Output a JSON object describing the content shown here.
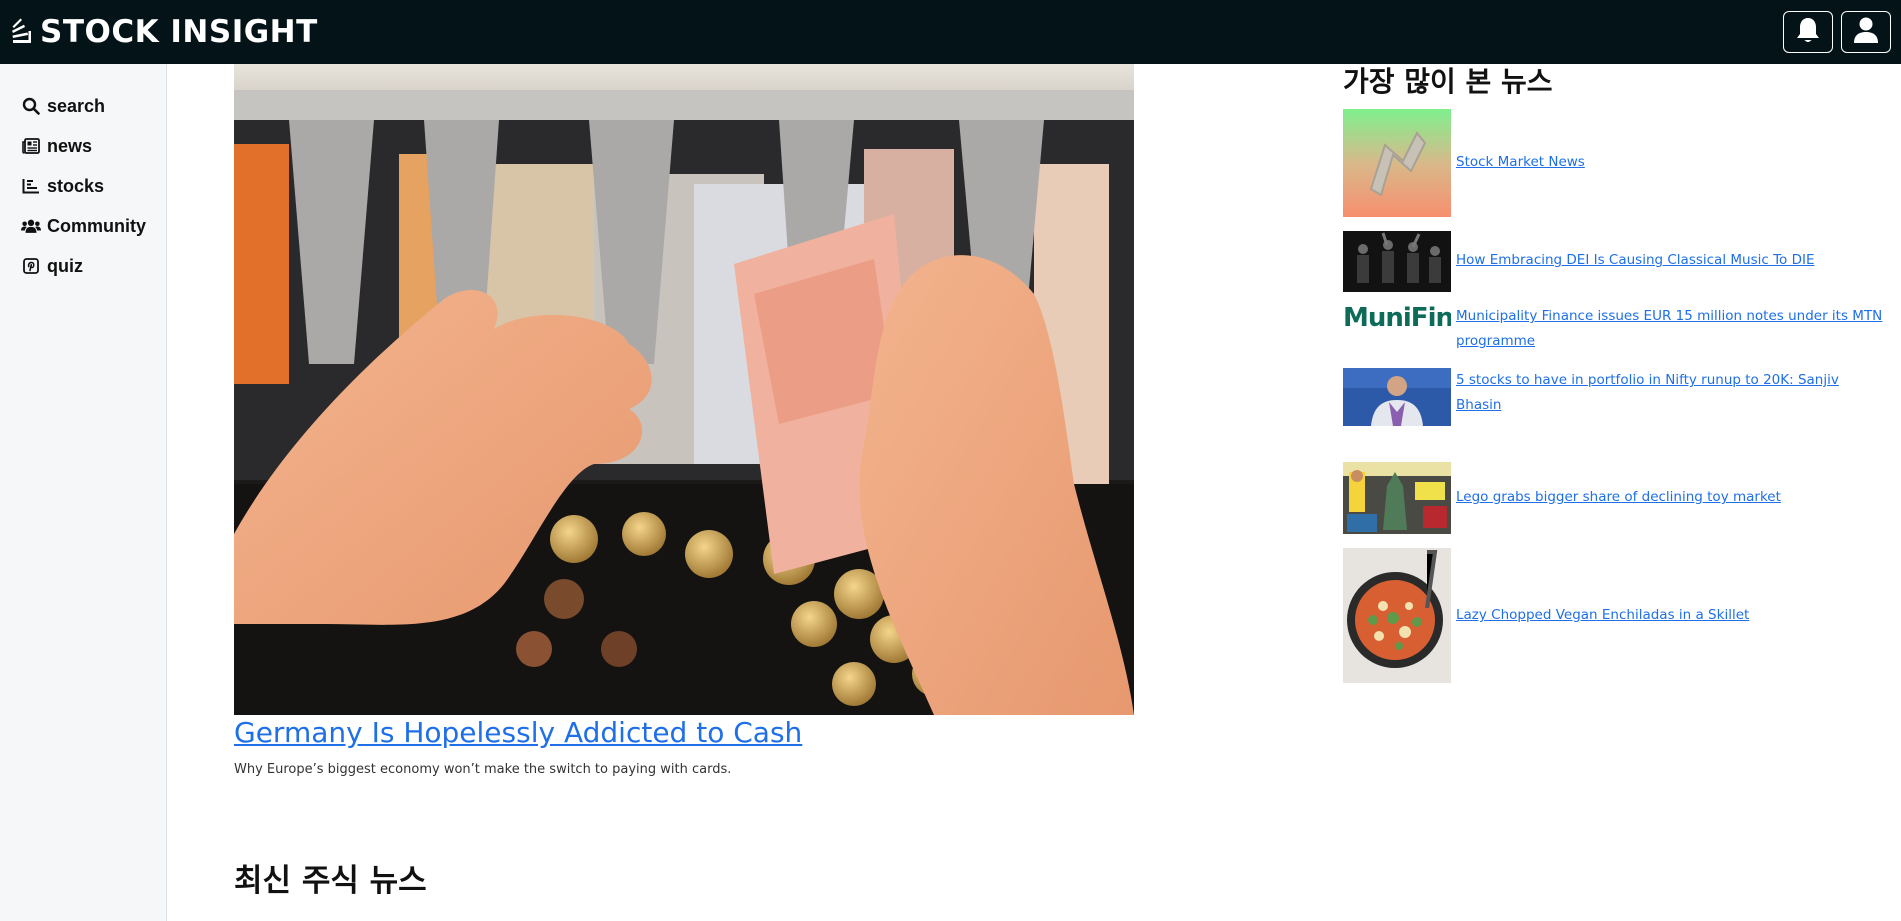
{
  "header": {
    "brand": "STOCK INSIGHT",
    "brand_icon": "layers-icon",
    "notifications_icon": "bell-icon",
    "profile_icon": "user-icon"
  },
  "sidebar": {
    "items": [
      {
        "label": "search",
        "icon": "search-icon"
      },
      {
        "label": "news",
        "icon": "newspaper-icon"
      },
      {
        "label": "stocks",
        "icon": "chart-bar-icon"
      },
      {
        "label": "Community",
        "icon": "users-icon"
      },
      {
        "label": "quiz",
        "icon": "pinterest-icon"
      }
    ]
  },
  "main": {
    "featured": {
      "title": "Germany Is Hopelessly Addicted to Cash",
      "description": "Why Europe’s biggest economy won’t make the switch to paying with cards."
    },
    "latest_section_title": "최신 주식 뉴스"
  },
  "popular": {
    "title": "가장 많이 본 뉴스",
    "items": [
      {
        "title": "Stock Market News"
      },
      {
        "title": "How Embracing DEI Is Causing Classical Music To DIE"
      },
      {
        "title": "Municipality Finance issues EUR 15 million notes under its MTN programme",
        "logo_text": "MuniFin"
      },
      {
        "title": "5 stocks to have in portfolio in Nifty runup to 20K: Sanjiv Bhasin"
      },
      {
        "title": "Lego grabs bigger share of declining toy market"
      },
      {
        "title": "Lazy Chopped Vegan Enchiladas in a Skillet"
      }
    ]
  },
  "colors": {
    "topbar": "#041318",
    "link": "#1e6fe8",
    "sidebar_bg": "#f6f7f9"
  }
}
